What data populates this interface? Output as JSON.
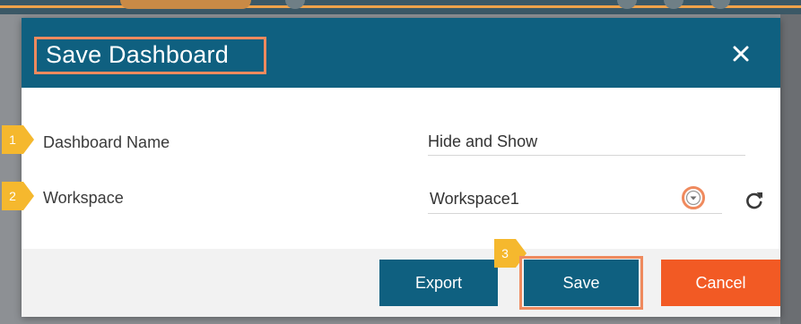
{
  "dialog": {
    "title": "Save Dashboard",
    "close_icon": "close-icon",
    "fields": {
      "dashboard_name": {
        "label": "Dashboard Name",
        "value": "Hide and Show"
      },
      "workspace": {
        "label": "Workspace",
        "selected": "Workspace1",
        "dropdown_icon": "chevron-down-icon",
        "refresh_icon": "refresh-icon"
      }
    },
    "buttons": {
      "export": "Export",
      "save": "Save",
      "cancel": "Cancel"
    }
  },
  "callouts": [
    "1",
    "2",
    "3"
  ],
  "colors": {
    "header": "#0f6080",
    "primary_button": "#0f6080",
    "cancel_button": "#f25a24",
    "highlight_outline": "#ef8a5e",
    "callout_badge": "#f5b82e"
  }
}
